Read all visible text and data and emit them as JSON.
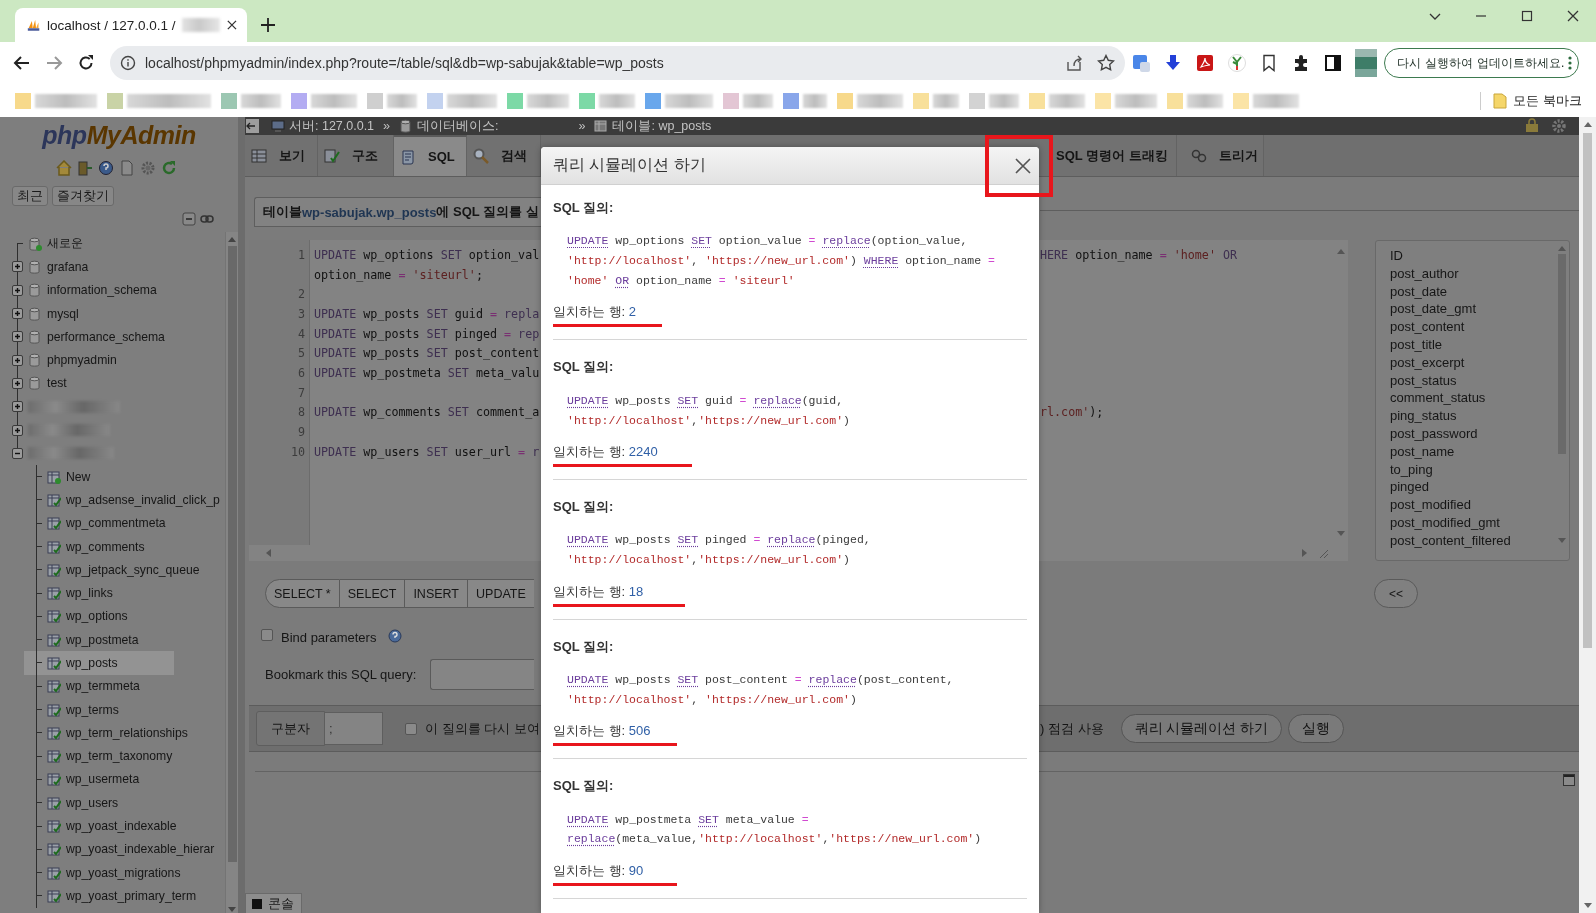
{
  "browser": {
    "tab_title": "localhost / 127.0.0.1 /",
    "url": "localhost/phpmyadmin/index.php?route=/table/sql&db=wp-sabujak&table=wp_posts",
    "update_button": "다시 실행하여 업데이트하세요.",
    "all_bookmarks": "모든 북마크",
    "bookmarks": [
      {
        "color": "#f7d98b"
      },
      {
        "color": "#c9d3a6"
      },
      {
        "color": "#9cc7b2"
      },
      {
        "color": "#b3acf2"
      },
      {
        "color": "#cfcfcf"
      },
      {
        "color": "#c3d2ef"
      },
      {
        "color": "#7cd9a6"
      },
      {
        "color": "#7cd9a6"
      },
      {
        "color": "#69a7ec"
      },
      {
        "color": "#e3c6d4"
      },
      {
        "color": "#89a6ea"
      },
      {
        "color": "#f7d98b"
      },
      {
        "color": "#f8e09b"
      },
      {
        "color": "#d3d3d3"
      },
      {
        "color": "#f8e09b"
      },
      {
        "color": "#fbe4a6"
      },
      {
        "color": "#f8e09b"
      },
      {
        "color": "#fbe4a6"
      }
    ]
  },
  "sidebar": {
    "logo_php": "php",
    "logo_myadmin": "MyAdmin",
    "buttons": [
      "최근",
      "즐겨찾기"
    ],
    "tree": [
      {
        "kind": "new",
        "label": "새로운"
      },
      {
        "kind": "database",
        "label": "grafana",
        "expanded": false
      },
      {
        "kind": "database",
        "label": "information_schema",
        "expanded": false
      },
      {
        "kind": "database",
        "label": "mysql",
        "expanded": false
      },
      {
        "kind": "database",
        "label": "performance_schema",
        "expanded": false
      },
      {
        "kind": "database",
        "label": "phpmyadmin",
        "expanded": false
      },
      {
        "kind": "database",
        "label": "test",
        "expanded": false
      },
      {
        "kind": "redacted",
        "expanded": false
      },
      {
        "kind": "redacted",
        "expanded": false
      },
      {
        "kind": "redacted",
        "expanded": true,
        "children": [
          {
            "kind": "new",
            "label": "New"
          },
          {
            "kind": "table",
            "label": "wp_adsense_invalid_click_p",
            "selected": false
          },
          {
            "kind": "table",
            "label": "wp_commentmeta",
            "selected": false
          },
          {
            "kind": "table",
            "label": "wp_comments",
            "selected": false
          },
          {
            "kind": "table",
            "label": "wp_jetpack_sync_queue",
            "selected": false
          },
          {
            "kind": "table",
            "label": "wp_links",
            "selected": false
          },
          {
            "kind": "table",
            "label": "wp_options",
            "selected": false
          },
          {
            "kind": "table",
            "label": "wp_postmeta",
            "selected": false
          },
          {
            "kind": "table",
            "label": "wp_posts",
            "selected": true
          },
          {
            "kind": "table",
            "label": "wp_termmeta",
            "selected": false
          },
          {
            "kind": "table",
            "label": "wp_terms",
            "selected": false
          },
          {
            "kind": "table",
            "label": "wp_term_relationships",
            "selected": false
          },
          {
            "kind": "table",
            "label": "wp_term_taxonomy",
            "selected": false
          },
          {
            "kind": "table",
            "label": "wp_usermeta",
            "selected": false
          },
          {
            "kind": "table",
            "label": "wp_users",
            "selected": false
          },
          {
            "kind": "table",
            "label": "wp_yoast_indexable",
            "selected": false
          },
          {
            "kind": "table",
            "label": "wp_yoast_indexable_hierar",
            "selected": false
          },
          {
            "kind": "table",
            "label": "wp_yoast_migrations",
            "selected": false
          },
          {
            "kind": "table",
            "label": "wp_yoast_primary_term",
            "selected": false
          }
        ]
      }
    ]
  },
  "main": {
    "breadcrumb": [
      {
        "kind": "server",
        "label": "서버: 127.0.0.1"
      },
      {
        "kind": "database",
        "separator": "»",
        "label": "데이터베이스:"
      },
      {
        "kind": "table",
        "separator": "»",
        "label": "테이블: wp_posts"
      }
    ],
    "tabs_left": [
      {
        "kind": "browse",
        "label": "보기",
        "selected": false
      },
      {
        "kind": "structure",
        "label": "구조",
        "selected": false
      },
      {
        "kind": "sql",
        "label": "SQL",
        "selected": true
      },
      {
        "kind": "search",
        "label": "검색",
        "selected": false
      }
    ],
    "tabs_right": [
      {
        "label": "SQL 명령어 트래킹",
        "selected": false
      },
      {
        "kind": "trigger",
        "label": "트리거",
        "selected": false
      }
    ],
    "title_prefix": "테이블 ",
    "title_link": "wp-sabujak.wp_posts",
    "title_suffix": "에 SQL 질의를 실",
    "editor_lines": [
      {
        "number": "1",
        "left": [
          {
            "kind": "kw",
            "text": "UPDATE"
          },
          {
            "kind": "id",
            "text": " wp_options "
          },
          {
            "kind": "kw",
            "text": "SET"
          },
          {
            "kind": "id",
            "text": " option_val"
          }
        ],
        "right": [
          {
            "kind": "kw",
            "text": "HERE"
          },
          {
            "kind": "id",
            "text": " option_name "
          },
          {
            "kind": "op",
            "text": "="
          },
          {
            "kind": "str",
            "text": " 'home' "
          },
          {
            "kind": "kw",
            "text": "OR"
          }
        ]
      },
      {
        "left": [
          {
            "kind": "id",
            "text": "option_name "
          },
          {
            "kind": "op",
            "text": "="
          },
          {
            "kind": "str",
            "text": " 'siteurl'"
          },
          {
            "kind": "id",
            "text": ";"
          }
        ]
      },
      {
        "number": "2"
      },
      {
        "number": "3",
        "left": [
          {
            "kind": "kw",
            "text": "UPDATE"
          },
          {
            "kind": "id",
            "text": " wp_posts "
          },
          {
            "kind": "kw",
            "text": "SET"
          },
          {
            "kind": "id",
            "text": " guid "
          },
          {
            "kind": "op",
            "text": "="
          },
          {
            "kind": "fn",
            "text": " repla"
          }
        ]
      },
      {
        "number": "4",
        "left": [
          {
            "kind": "kw",
            "text": "UPDATE"
          },
          {
            "kind": "id",
            "text": " wp_posts "
          },
          {
            "kind": "kw",
            "text": "SET"
          },
          {
            "kind": "id",
            "text": " pinged "
          },
          {
            "kind": "op",
            "text": "="
          },
          {
            "kind": "fn",
            "text": " rep"
          }
        ]
      },
      {
        "number": "5",
        "left": [
          {
            "kind": "kw",
            "text": "UPDATE"
          },
          {
            "kind": "id",
            "text": " wp_posts "
          },
          {
            "kind": "kw",
            "text": "SET"
          },
          {
            "kind": "id",
            "text": " post_content"
          }
        ]
      },
      {
        "number": "6",
        "left": [
          {
            "kind": "kw",
            "text": "UPDATE"
          },
          {
            "kind": "id",
            "text": " wp_postmeta "
          },
          {
            "kind": "kw",
            "text": "SET"
          },
          {
            "kind": "id",
            "text": " meta_valu"
          }
        ]
      },
      {
        "number": "7"
      },
      {
        "number": "8",
        "left": [
          {
            "kind": "kw",
            "text": "UPDATE"
          },
          {
            "kind": "id",
            "text": " wp_comments "
          },
          {
            "kind": "kw",
            "text": "SET"
          },
          {
            "kind": "id",
            "text": " comment_a"
          }
        ],
        "right": [
          {
            "kind": "str",
            "text": "rl.com'"
          },
          {
            "kind": "id",
            "text": ");"
          }
        ]
      },
      {
        "number": "9"
      },
      {
        "number": "10",
        "left": [
          {
            "kind": "kw",
            "text": "UPDATE"
          },
          {
            "kind": "id",
            "text": " wp_users "
          },
          {
            "kind": "kw",
            "text": "SET"
          },
          {
            "kind": "id",
            "text": " user_url "
          },
          {
            "kind": "op",
            "text": "="
          },
          {
            "kind": "fn",
            "text": " r"
          }
        ]
      }
    ],
    "columns": [
      "ID",
      "post_author",
      "post_date",
      "post_date_gmt",
      "post_content",
      "post_title",
      "post_excerpt",
      "post_status",
      "comment_status",
      "ping_status",
      "post_password",
      "post_name",
      "to_ping",
      "pinged",
      "post_modified",
      "post_modified_gmt",
      "post_content_filtered"
    ],
    "query_buttons": [
      "SELECT *",
      "SELECT",
      "INSERT",
      "UPDATE"
    ],
    "insert_button": "<<",
    "bind_parameters": {
      "label": "Bind parameters",
      "checked": false
    },
    "bookmark_label": "Bookmark this SQL query:",
    "delimiter_label": "구분자",
    "delimiter_value": ";",
    "show_again": {
      "label": "이 질의를 다시 보여",
      "checked": false
    },
    "check_text": ") 점검 사용",
    "action_buttons": [
      "쿼리 시뮬레이션 하기",
      "실행"
    ],
    "console": "콘솔"
  },
  "dialog": {
    "title": "쿼리 시뮬레이션 하기",
    "close_highlighted": true,
    "queries": [
      {
        "label": "SQL 질의:",
        "result_label": "일치하는 행: ",
        "result_value": "2",
        "highlighted": true,
        "lines": [
          [
            {
              "kind": "kw",
              "text": "UPDATE"
            },
            {
              "kind": "id",
              "text": " wp_options "
            },
            {
              "kind": "kw",
              "text": "SET"
            },
            {
              "kind": "id",
              "text": " option_value "
            },
            {
              "kind": "op",
              "text": "= "
            },
            {
              "kind": "fn",
              "text": "replace"
            },
            {
              "kind": "id",
              "text": "(option_value,"
            }
          ],
          [
            {
              "kind": "str",
              "text": "'http://localhost'"
            },
            {
              "kind": "id",
              "text": ", "
            },
            {
              "kind": "str",
              "text": "'https://new_url.com'"
            },
            {
              "kind": "id",
              "text": ") "
            },
            {
              "kind": "kw",
              "text": "WHERE"
            },
            {
              "kind": "id",
              "text": " option_name "
            },
            {
              "kind": "op",
              "text": "="
            }
          ],
          [
            {
              "kind": "str",
              "text": "'home' "
            },
            {
              "kind": "kw",
              "text": "OR"
            },
            {
              "kind": "id",
              "text": " option_name "
            },
            {
              "kind": "op",
              "text": "= "
            },
            {
              "kind": "str",
              "text": "'siteurl'"
            }
          ]
        ]
      },
      {
        "label": "SQL 질의:",
        "result_label": "일치하는 행: ",
        "result_value": "2240",
        "highlighted": true,
        "lines": [
          [
            {
              "kind": "kw",
              "text": "UPDATE"
            },
            {
              "kind": "id",
              "text": " wp_posts "
            },
            {
              "kind": "kw",
              "text": "SET"
            },
            {
              "kind": "id",
              "text": " guid "
            },
            {
              "kind": "op",
              "text": "= "
            },
            {
              "kind": "fn",
              "text": "replace"
            },
            {
              "kind": "id",
              "text": "(guid,"
            }
          ],
          [
            {
              "kind": "str",
              "text": "'http://localhost'"
            },
            {
              "kind": "id",
              "text": ","
            },
            {
              "kind": "str",
              "text": "'https://new_url.com'"
            },
            {
              "kind": "id",
              "text": ")"
            }
          ]
        ]
      },
      {
        "label": "SQL 질의:",
        "result_label": "일치하는 행: ",
        "result_value": "18",
        "highlighted": true,
        "lines": [
          [
            {
              "kind": "kw",
              "text": "UPDATE"
            },
            {
              "kind": "id",
              "text": " wp_posts "
            },
            {
              "kind": "kw",
              "text": "SET"
            },
            {
              "kind": "id",
              "text": " pinged "
            },
            {
              "kind": "op",
              "text": "= "
            },
            {
              "kind": "fn",
              "text": "replace"
            },
            {
              "kind": "id",
              "text": "(pinged,"
            }
          ],
          [
            {
              "kind": "str",
              "text": "'http://localhost'"
            },
            {
              "kind": "id",
              "text": ","
            },
            {
              "kind": "str",
              "text": "'https://new_url.com'"
            },
            {
              "kind": "id",
              "text": ")"
            }
          ]
        ]
      },
      {
        "label": "SQL 질의:",
        "result_label": "일치하는 행: ",
        "result_value": "506",
        "highlighted": true,
        "lines": [
          [
            {
              "kind": "kw",
              "text": "UPDATE"
            },
            {
              "kind": "id",
              "text": " wp_posts "
            },
            {
              "kind": "kw",
              "text": "SET"
            },
            {
              "kind": "id",
              "text": " post_content "
            },
            {
              "kind": "op",
              "text": "= "
            },
            {
              "kind": "fn",
              "text": "replace"
            },
            {
              "kind": "id",
              "text": "(post_content,"
            }
          ],
          [
            {
              "kind": "str",
              "text": "'http://localhost'"
            },
            {
              "kind": "id",
              "text": ", "
            },
            {
              "kind": "str",
              "text": "'https://new_url.com'"
            },
            {
              "kind": "id",
              "text": ")"
            }
          ]
        ]
      },
      {
        "label": "SQL 질의:",
        "result_label": "일치하는 행: ",
        "result_value": "90",
        "highlighted": true,
        "lines": [
          [
            {
              "kind": "kw",
              "text": "UPDATE"
            },
            {
              "kind": "id",
              "text": " wp_postmeta "
            },
            {
              "kind": "kw",
              "text": "SET"
            },
            {
              "kind": "id",
              "text": " meta_value "
            },
            {
              "kind": "op",
              "text": "="
            }
          ],
          [
            {
              "kind": "fn",
              "text": "replace"
            },
            {
              "kind": "id",
              "text": "(meta_value,"
            },
            {
              "kind": "str",
              "text": "'http://localhost'"
            },
            {
              "kind": "id",
              "text": ","
            },
            {
              "kind": "str",
              "text": "'https://new_url.com'"
            },
            {
              "kind": "id",
              "text": ")"
            }
          ]
        ]
      }
    ]
  }
}
